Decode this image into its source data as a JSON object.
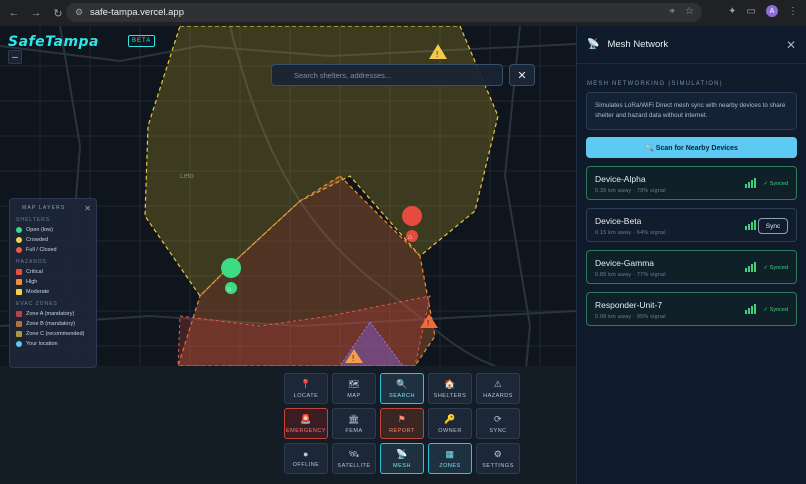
{
  "browser": {
    "url": "safe-tampa.vercel.app",
    "avatar_letter": "A"
  },
  "app": {
    "logo": "SafeTampa",
    "badge": "BETA",
    "zoom_out": "–"
  },
  "search": {
    "placeholder": "Search shelters, addresses...",
    "close": "✕"
  },
  "map": {
    "place_label": "Leto"
  },
  "layers": {
    "title": "MAP LAYERS",
    "close": "✕",
    "sections": [
      {
        "title": "SHELTERS",
        "items": [
          {
            "label": "Open (low)",
            "color": "#3ddc84",
            "shape": "dot"
          },
          {
            "label": "Crowded",
            "color": "#f2d14b",
            "shape": "dot"
          },
          {
            "label": "Full / Closed",
            "color": "#ef5a4a",
            "shape": "dot"
          }
        ]
      },
      {
        "title": "HAZARDS",
        "items": [
          {
            "label": "Critical",
            "color": "#ef4b3e",
            "shape": "sq"
          },
          {
            "label": "High",
            "color": "#f28c3a",
            "shape": "sq"
          },
          {
            "label": "Moderate",
            "color": "#f2d14b",
            "shape": "sq"
          }
        ]
      },
      {
        "title": "EVAC ZONES",
        "items": [
          {
            "label": "Zone A (mandatory)",
            "color": "#b8414a",
            "shape": "sq"
          },
          {
            "label": "Zone B (mandatory)",
            "color": "#b5733a",
            "shape": "sq"
          },
          {
            "label": "Zone C (recommended)",
            "color": "#a69a3a",
            "shape": "sq"
          },
          {
            "label": "Your location",
            "color": "#5ccaf2",
            "shape": "dot"
          }
        ]
      }
    ]
  },
  "toolbar": [
    {
      "label": "LOCATE",
      "icon": "📍",
      "state": ""
    },
    {
      "label": "MAP",
      "icon": "🗺",
      "state": ""
    },
    {
      "label": "SEARCH",
      "icon": "🔍",
      "state": "active"
    },
    {
      "label": "SHELTERS",
      "icon": "🏠",
      "state": ""
    },
    {
      "label": "HAZARDS",
      "icon": "⚠",
      "state": ""
    },
    {
      "label": "EMERGENCY",
      "icon": "🚨",
      "state": "danger"
    },
    {
      "label": "FEMA",
      "icon": "🏛",
      "state": ""
    },
    {
      "label": "REPORT",
      "icon": "⚑",
      "state": "report"
    },
    {
      "label": "OWNER",
      "icon": "🔑",
      "state": ""
    },
    {
      "label": "SYNC",
      "icon": "⟳",
      "state": ""
    },
    {
      "label": "OFFLINE",
      "icon": "●",
      "state": ""
    },
    {
      "label": "SATELLITE",
      "icon": "🛰",
      "state": ""
    },
    {
      "label": "MESH",
      "icon": "📡",
      "state": "active"
    },
    {
      "label": "ZONES",
      "icon": "▦",
      "state": "active"
    },
    {
      "label": "SETTINGS",
      "icon": "⚙",
      "state": ""
    }
  ],
  "panel": {
    "title": "Mesh Network",
    "close": "✕",
    "section_label": "MESH NETWORKING (SIMULATION)",
    "description": "Simulates LoRa/WiFi Direct mesh sync with nearby devices to share shelter and hazard data without internet.",
    "scan_button": "🔍 Scan for Nearby Devices",
    "devices": [
      {
        "name": "Device-Alpha",
        "meta": "0.35 km away · 79% signal",
        "status": "✓ Synced",
        "synced": true
      },
      {
        "name": "Device-Beta",
        "meta": "0.15 km away · 64% signal",
        "status": "Sync",
        "synced": false
      },
      {
        "name": "Device-Gamma",
        "meta": "0.85 km away · 77% signal",
        "status": "✓ Synced",
        "synced": true
      },
      {
        "name": "Responder-Unit-7",
        "meta": "0.08 km away · 95% signal",
        "status": "✓ Synced",
        "synced": true
      }
    ]
  }
}
